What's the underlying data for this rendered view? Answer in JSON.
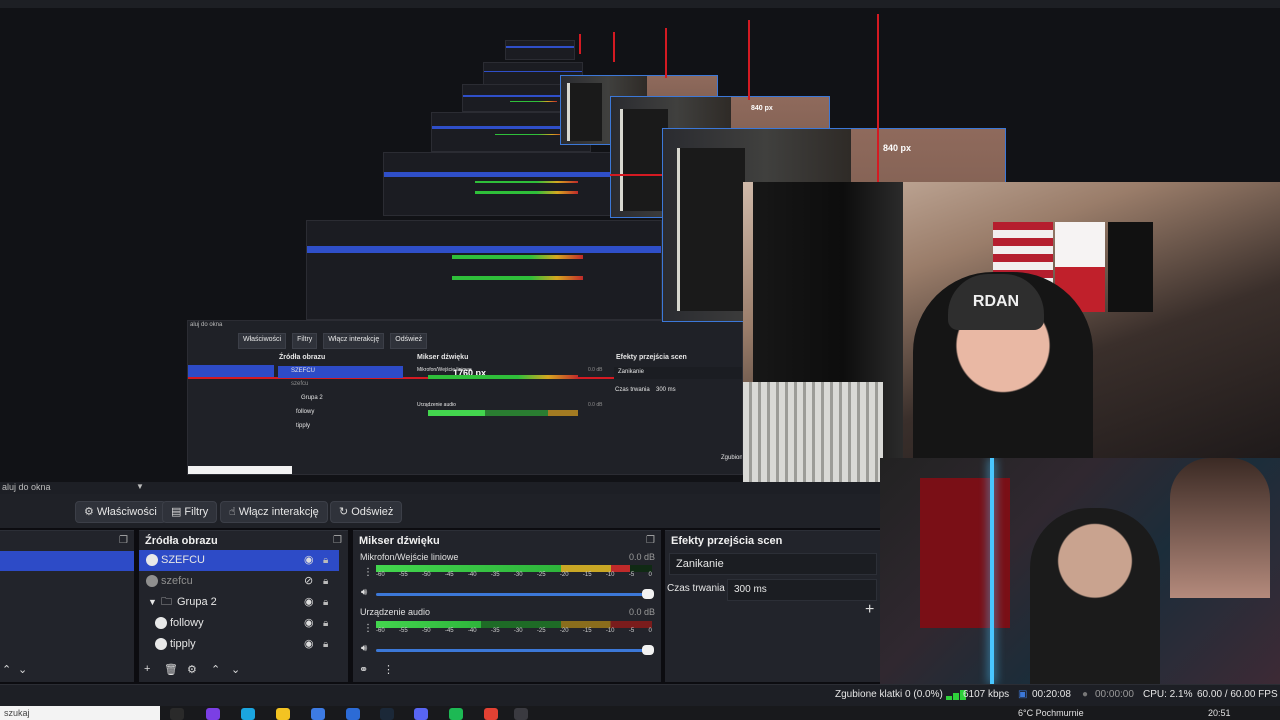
{
  "preview": {
    "px_label_large": "840 px",
    "px_label_small": "840 px",
    "nested_px_label": "1760 px",
    "nested_dock_title": "aluj do okna",
    "nested_buttons": [
      "Właściwości",
      "Filtry",
      "Włącz interakcję",
      "Odśwież"
    ],
    "nested_headers": [
      "Źródła obrazu",
      "Mikser dźwięku",
      "Efekty przejścia scen"
    ],
    "nested_sources": [
      "SZEFCU",
      "szefcu",
      "Grupa 2",
      "followy",
      "tipply"
    ],
    "nested_mixer": [
      "Mikrofon/Wejście liniowe",
      "Urządzenie audio"
    ],
    "nested_db": "0.0 dB",
    "nested_transition": "Zanikanie",
    "nested_duration_label": "Czas trwania",
    "nested_duration": "300 ms",
    "nested_footer": "Zgubion"
  },
  "webcam": {
    "beanie_text": "RDAN"
  },
  "dock": {
    "scale_label": "aluj do okna"
  },
  "toolbar": {
    "properties": "Właściwości",
    "filters": "Filtry",
    "interact": "Włącz interakcję",
    "refresh": "Odśwież"
  },
  "scenes": {
    "header": ""
  },
  "sources": {
    "header": "Źródła obrazu",
    "items": [
      {
        "label": "SZEFCU",
        "selected": true,
        "visible": true
      },
      {
        "label": "szefcu",
        "selected": false,
        "visible": false
      },
      {
        "label": "Grupa 2",
        "selected": false,
        "visible": true
      },
      {
        "label": "followy",
        "selected": false,
        "visible": true
      },
      {
        "label": "tipply",
        "selected": false,
        "visible": true
      }
    ]
  },
  "mixer": {
    "header": "Mikser dźwięku",
    "ticks": [
      "-60",
      "-55",
      "-50",
      "-45",
      "-40",
      "-35",
      "-30",
      "-25",
      "-20",
      "-15",
      "-10",
      "-5",
      "0"
    ],
    "channels": [
      {
        "name": "Mikrofon/Wejście liniowe",
        "db": "0.0 dB",
        "level": 0.92
      },
      {
        "name": "Urządzenie audio",
        "db": "0.0 dB",
        "level": 0.38
      }
    ]
  },
  "transitions": {
    "header": "Efekty przejścia scen",
    "selected": "Zanikanie",
    "duration_label": "Czas trwania",
    "duration_value": "300 ms"
  },
  "status": {
    "dropped": "Zgubione klatki 0 (0.0%)",
    "bitrate": "6107 kbps",
    "rec_time": "00:20:08",
    "stream_time": "00:00:00",
    "cpu": "CPU: 2.1%",
    "fps": "60.00 / 60.00 FPS"
  },
  "taskbar": {
    "search": "szukaj",
    "weather": "6°C  Pochmurnie",
    "time": "20:51"
  },
  "colors": {
    "selection": "#2d4bc7",
    "accent": "#3c78d8",
    "meter_green": "#43d64e",
    "meter_red": "#c02a2a",
    "guide_red": "#d41a22"
  }
}
